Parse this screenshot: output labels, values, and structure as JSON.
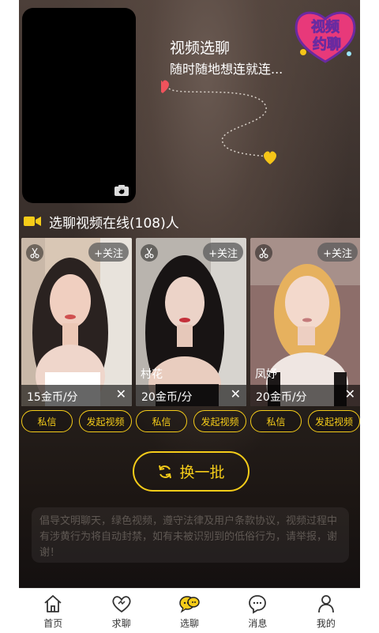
{
  "header": {
    "title": "视频选聊",
    "subtitle": "随时随地想连就连...",
    "badge_line1": "视频",
    "badge_line2": "约聊"
  },
  "section": {
    "label": "选聊视频在线(108)人"
  },
  "cards": [
    {
      "name": "",
      "price": "15金币/分",
      "follow": "+关注",
      "close": "✕",
      "dm": "私信",
      "call": "发起视频"
    },
    {
      "name": "村花",
      "price": "20金币/分",
      "follow": "+关注",
      "close": "✕",
      "dm": "私信",
      "call": "发起视频"
    },
    {
      "name": "凤妤",
      "price": "20金币/分",
      "follow": "+关注",
      "close": "✕",
      "dm": "私信",
      "call": "发起视频"
    }
  ],
  "swap_button": {
    "label": "换一批"
  },
  "notice": "倡导文明聊天，绿色视频，遵守法律及用户条款协议，视频过程中有涉黄行为将自动封禁，如有未被识别到的低俗行为，请举报，谢谢！",
  "tabs": [
    {
      "label": "首页",
      "icon": "home-icon",
      "active": false
    },
    {
      "label": "求聊",
      "icon": "heart-icon",
      "active": false
    },
    {
      "label": "选聊",
      "icon": "chat-bubbles-icon",
      "active": true
    },
    {
      "label": "消息",
      "icon": "message-icon",
      "active": false
    },
    {
      "label": "我的",
      "icon": "profile-icon",
      "active": false
    }
  ],
  "colors": {
    "accent": "#f5cc19",
    "heart_red": "#f0535c",
    "heart_yellow": "#f5c518",
    "badge_pink": "#e8397a"
  }
}
